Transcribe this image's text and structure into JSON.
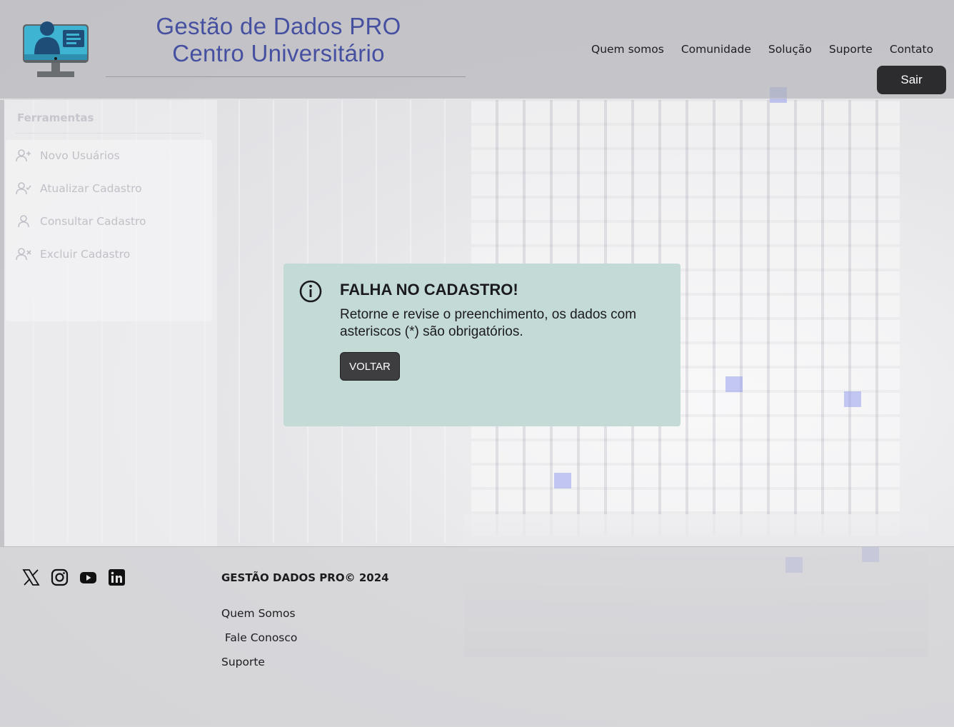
{
  "header": {
    "brand_line1": "Gestão de Dados PRO",
    "brand_line2": "Centro Universitário",
    "nav": [
      "Quem somos",
      "Comunidade",
      "Solução",
      "Suporte",
      "Contato"
    ],
    "logout_label": "Sair"
  },
  "sidebar": {
    "title": "Ferramentas",
    "items": [
      {
        "label": "Novo Usuários",
        "icon": "user-plus-icon"
      },
      {
        "label": "Atualizar Cadastro",
        "icon": "user-check-icon"
      },
      {
        "label": "Consultar Cadastro",
        "icon": "user-icon"
      },
      {
        "label": "Excluir Cadastro",
        "icon": "user-x-icon"
      }
    ]
  },
  "alert": {
    "icon": "info-icon",
    "title": "FALHA NO CADASTRO!",
    "message": "Retorne e revise o preenchimento, os dados com asteriscos (*) são obrigatórios.",
    "button_label": "VOLTAR"
  },
  "footer": {
    "social_icons": [
      "x-icon",
      "instagram-icon",
      "youtube-icon",
      "linkedin-icon"
    ],
    "copyright": "GESTÃO DADOS PRO© 2024",
    "links": [
      "Quem Somos",
      " Fale Conosco",
      "Suporte"
    ]
  },
  "colors": {
    "brand_text": "#4650a0",
    "alert_bg": "#c4dad7",
    "button_dark": "#2c2c2e"
  }
}
